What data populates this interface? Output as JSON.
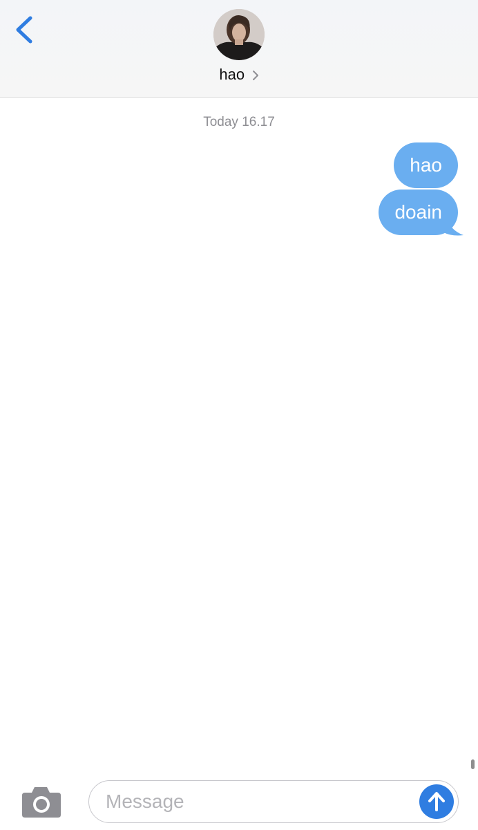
{
  "header": {
    "contact_name": "hao",
    "back_icon": "chevron-left-icon",
    "contact_chevron_icon": "chevron-right-icon",
    "accent_color": "#2f7de1"
  },
  "conversation": {
    "timestamp": "Today 16.17",
    "messages": [
      {
        "text": "hao",
        "direction": "sent"
      },
      {
        "text": "doain",
        "direction": "sent"
      }
    ],
    "sent_bubble_color": "#6aaef0"
  },
  "composer": {
    "placeholder": "Message",
    "camera_icon": "camera-icon",
    "send_icon": "arrow-up-icon"
  }
}
